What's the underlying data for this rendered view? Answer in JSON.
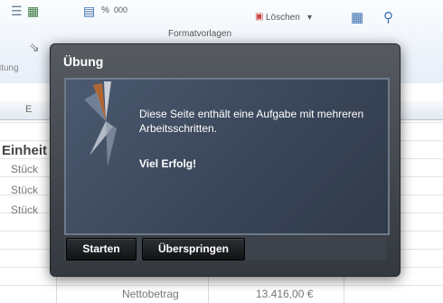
{
  "ribbon": {
    "percent": "%",
    "thousands": "000",
    "styles_group": "Formatvorlagen",
    "delete": "Löschen",
    "partial_left": "itung"
  },
  "sheet": {
    "column_e": "E",
    "header_cell": "Einheit",
    "units": [
      "Stück",
      "Stück",
      "Stück"
    ],
    "net_label": "Nettobetrag",
    "net_value": "13.416,00 €"
  },
  "dialog": {
    "title": "Übung",
    "message": "Diese Seite enthält eine Aufgabe mit mehreren Arbeitsschritten.",
    "strong_text": "Viel Erfolg!",
    "start_label": "Starten",
    "skip_label": "Überspringen"
  }
}
